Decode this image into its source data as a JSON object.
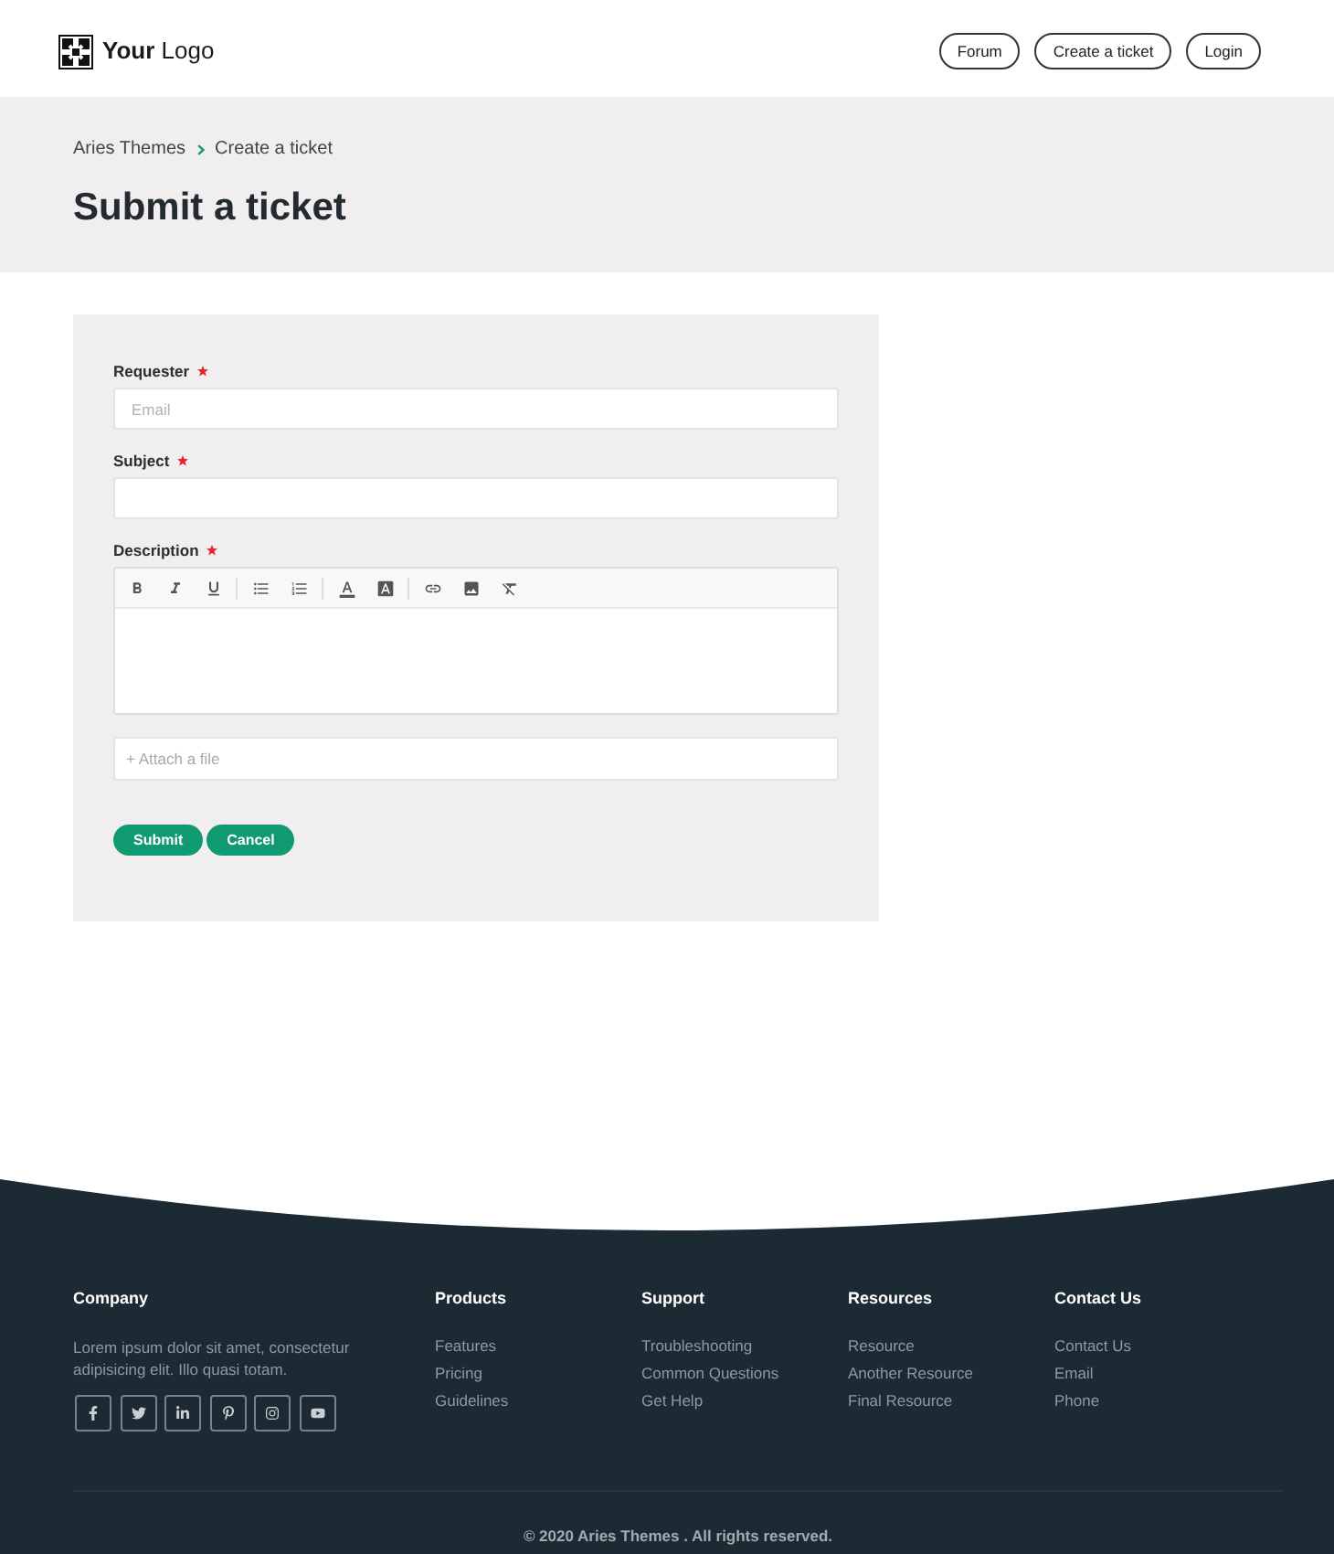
{
  "header": {
    "logo": "**Your** Logo",
    "nav": [
      {
        "label": "Forum"
      },
      {
        "label": "Create a ticket"
      },
      {
        "label": "Login"
      }
    ]
  },
  "breadcrumb": [
    {
      "label": "Aries Themes"
    },
    {
      "label": "Create a ticket"
    }
  ],
  "page_title": "Submit a ticket",
  "form": {
    "fields": [
      {
        "kind": "input",
        "label": "Requester",
        "required": true,
        "placeholder": "Email"
      },
      {
        "kind": "input",
        "label": "Subject",
        "required": true
      },
      {
        "kind": "editor",
        "label": "Description",
        "required": true,
        "toolbar_groups": [
          {
            "tools": [
              {
                "kind": "bold"
              },
              {
                "kind": "italic"
              },
              {
                "kind": "underline"
              }
            ]
          },
          {
            "tools": [
              {
                "kind": "bulleted_list"
              },
              {
                "kind": "numbered_list"
              }
            ]
          },
          {
            "tools": [
              {
                "kind": "text_color"
              },
              {
                "kind": "highlight"
              }
            ]
          },
          {
            "tools": [
              {
                "kind": "link"
              },
              {
                "kind": "image"
              },
              {
                "kind": "clear_format"
              }
            ]
          }
        ]
      }
    ],
    "attachment": {
      "label": "+ Attach a file"
    },
    "buttons": [
      {
        "label": "Submit"
      },
      {
        "label": "Cancel"
      }
    ]
  },
  "footer": {
    "columns": [
      {
        "title": "Company",
        "text": "Lorem ipsum dolor sit amet, consectetur adipisicing elit. Illo quasi totam.",
        "social": [
          {
            "kind": "facebook"
          },
          {
            "kind": "twitter"
          },
          {
            "kind": "linkedin"
          },
          {
            "kind": "pinterest"
          },
          {
            "kind": "instagram"
          },
          {
            "kind": "youtube"
          }
        ]
      },
      {
        "title": "Products",
        "links": [
          "Features",
          "Pricing",
          "Guidelines"
        ]
      },
      {
        "title": "Support",
        "links": [
          "Troubleshooting",
          "Common Questions",
          "Get Help"
        ]
      },
      {
        "title": "Resources",
        "links": [
          "Resource",
          "Another Resource",
          "Final Resource"
        ]
      },
      {
        "title": "Contact Us",
        "links": [
          "Contact Us",
          "Email",
          "Phone"
        ]
      }
    ],
    "copyright": "© 2020 Aries Themes . All rights reserved."
  }
}
